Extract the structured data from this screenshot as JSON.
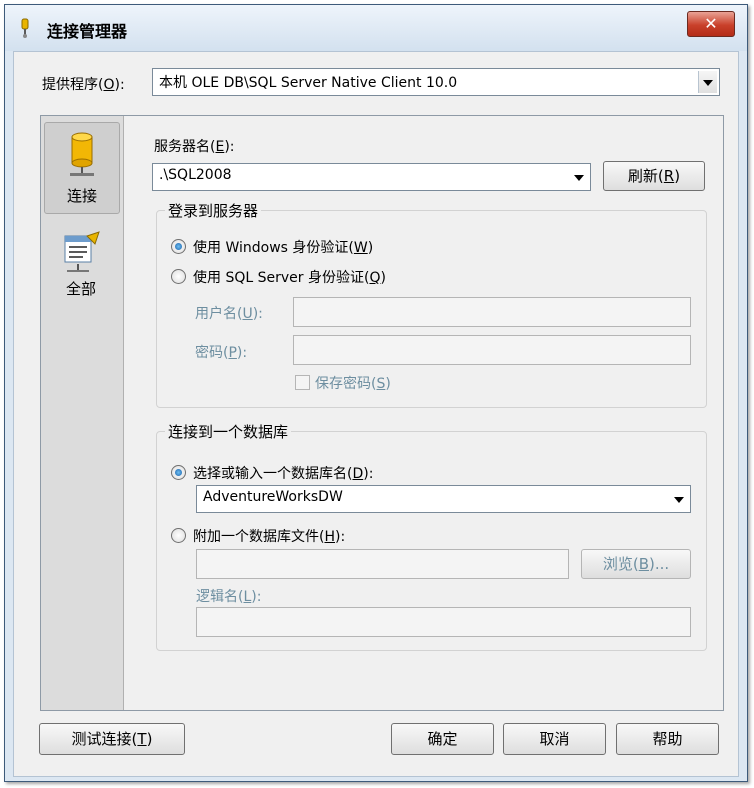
{
  "window": {
    "title": "连接管理器",
    "close_glyph": "✕"
  },
  "provider": {
    "label": "提供程序(",
    "label_key": "O",
    "label_end": "):",
    "value": "本机 OLE DB\\SQL Server Native Client 10.0"
  },
  "sidebar": {
    "items": [
      {
        "label": "连接",
        "icon": "database-cylinder-icon",
        "selected": true
      },
      {
        "label": "全部",
        "icon": "properties-list-icon",
        "selected": false
      }
    ]
  },
  "server": {
    "label": "服务器名(",
    "label_key": "E",
    "label_end": "):",
    "value": ".\\SQL2008",
    "refresh_label": "刷新(",
    "refresh_key": "R",
    "refresh_end": ")"
  },
  "login": {
    "group_title": "登录到服务器",
    "windows_auth": {
      "label": "使用 Windows 身份验证(",
      "key": "W",
      "end": ")",
      "checked": true
    },
    "sql_auth": {
      "label": "使用 SQL Server 身份验证(",
      "key": "Q",
      "end": ")",
      "checked": false
    },
    "username": {
      "label": "用户名(",
      "key": "U",
      "end": "):",
      "value": ""
    },
    "password": {
      "label": "密码(",
      "key": "P",
      "end": "):",
      "value": ""
    },
    "save_password": {
      "label": "保存密码(",
      "key": "S",
      "end": ")",
      "checked": false
    }
  },
  "database": {
    "group_title": "连接到一个数据库",
    "select_db": {
      "label": "选择或输入一个数据库名(",
      "key": "D",
      "end": "):",
      "checked": true,
      "value": "AdventureWorksDW"
    },
    "attach_db": {
      "label": "附加一个数据库文件(",
      "key": "H",
      "end": "):",
      "checked": false,
      "value": ""
    },
    "browse": {
      "label": "浏览(",
      "key": "B",
      "end": ")..."
    },
    "logical_name": {
      "label": "逻辑名(",
      "key": "L",
      "end": "):",
      "value": ""
    }
  },
  "footer": {
    "test_label": "测试连接(",
    "test_key": "T",
    "test_end": ")",
    "ok_label": "确定",
    "cancel_label": "取消",
    "help_label": "帮助"
  },
  "colors": {
    "title_bar": "#d3e1ef",
    "close_button": "#c9402a",
    "disabled_text": "#6d8ea0",
    "radio_selected": "#1a5fa8"
  }
}
